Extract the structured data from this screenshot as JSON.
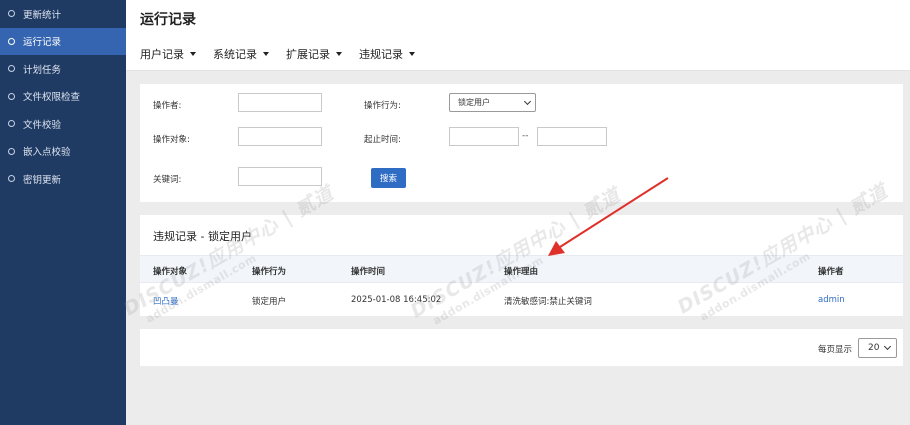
{
  "sidebar": {
    "items": [
      {
        "label": "更新统计"
      },
      {
        "label": "运行记录"
      },
      {
        "label": "计划任务"
      },
      {
        "label": "文件权限检查"
      },
      {
        "label": "文件校验"
      },
      {
        "label": "嵌入点校验"
      },
      {
        "label": "密钥更新"
      }
    ],
    "active_index": 1
  },
  "header": {
    "title": "运行记录",
    "tabs": [
      {
        "label": "用户记录"
      },
      {
        "label": "系统记录"
      },
      {
        "label": "扩展记录"
      },
      {
        "label": "违规记录"
      }
    ]
  },
  "filter": {
    "operator_label": "操作者:",
    "operator_value": "",
    "action_label": "操作行为:",
    "action_selected": "锁定用户",
    "target_label": "操作对象:",
    "target_value": "",
    "time_label": "起止时间:",
    "time_start": "",
    "time_separator": "--",
    "time_end": "",
    "keyword_label": "关键词:",
    "keyword_value": "",
    "search_button": "搜索"
  },
  "results": {
    "title": "违规记录 - 锁定用户",
    "columns": [
      "操作对象",
      "操作行为",
      "操作时间",
      "操作理由",
      "操作者"
    ],
    "rows": [
      {
        "target": "凹凸曼",
        "action": "锁定用户",
        "time": "2025-01-08 16:45:02",
        "reason": "清洗敏感词:禁止关键词",
        "operator": "admin"
      }
    ]
  },
  "pager": {
    "per_page_label": "每页显示",
    "per_page_value": "20"
  },
  "watermark": {
    "main": "DISCUZ!应用中心 | 贰道",
    "sub": "addon.dismall.com"
  },
  "colors": {
    "sidebar_bg": "#1f3a63",
    "sidebar_active": "#3565b0",
    "accent": "#2f6cc4",
    "annotation_arrow": "#e0302a"
  }
}
